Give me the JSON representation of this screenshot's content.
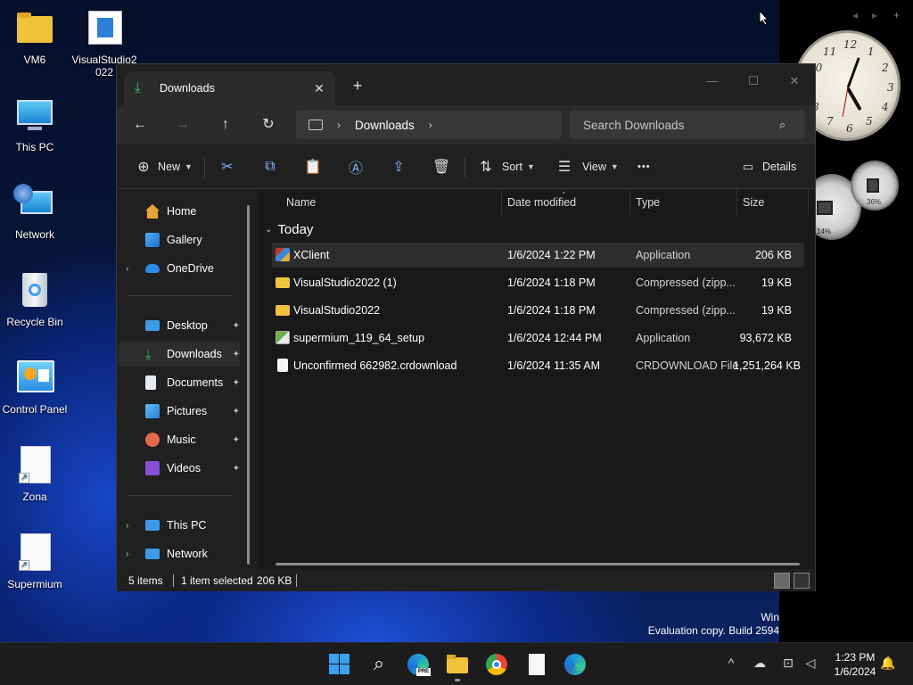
{
  "desktop": {
    "icons": [
      {
        "label": "VM6"
      },
      {
        "label": "VisualStudio2022"
      },
      {
        "label": "This PC"
      },
      {
        "label": "Network"
      },
      {
        "label": "Recycle Bin"
      },
      {
        "label": "Control Panel"
      },
      {
        "label": "Zona"
      },
      {
        "label": "Supermium"
      }
    ],
    "gauge_left_value": "14%",
    "gauge_right_value": "36%",
    "watermark": {
      "line1": "Win",
      "line2": "Evaluation copy. Build 2594"
    }
  },
  "window": {
    "tab_title": "Downloads",
    "tab_close": "✕",
    "new_tab": "+",
    "controls": {
      "minimize": "—",
      "maximize": "☐",
      "close": "✕"
    },
    "nav": {
      "back": "←",
      "forward": "→",
      "up": "↑",
      "refresh": "↻"
    },
    "address": {
      "chevron": "›",
      "crumb": "Downloads",
      "chevron_end": "›"
    },
    "search_placeholder": "Search Downloads",
    "toolbar": {
      "new_label": "New",
      "sort_label": "Sort",
      "view_label": "View",
      "more_label": "•••",
      "details_label": "Details"
    },
    "sidebar": {
      "items": [
        {
          "label": "Home",
          "icon": "home-icon"
        },
        {
          "label": "Gallery",
          "icon": "gallery-icon"
        },
        {
          "label": "OneDrive",
          "icon": "onedrive-icon"
        },
        {
          "label": "Desktop",
          "icon": "desktop-icon"
        },
        {
          "label": "Downloads",
          "icon": "downloads-icon"
        },
        {
          "label": "Documents",
          "icon": "documents-icon"
        },
        {
          "label": "Pictures",
          "icon": "pictures-icon"
        },
        {
          "label": "Music",
          "icon": "music-icon"
        },
        {
          "label": "Videos",
          "icon": "videos-icon"
        },
        {
          "label": "This PC",
          "icon": "this-pc-icon"
        },
        {
          "label": "Network",
          "icon": "network-icon"
        }
      ],
      "expand_arrow": "›",
      "pin": "📌"
    },
    "columns": {
      "name": "Name",
      "date": "Date modified",
      "type": "Type",
      "size": "Size"
    },
    "group": {
      "label": "Today",
      "caret": "⌄"
    },
    "files": [
      {
        "name": "XClient",
        "date": "1/6/2024 1:22 PM",
        "type": "Application",
        "size": "206 KB"
      },
      {
        "name": "VisualStudio2022 (1)",
        "date": "1/6/2024 1:18 PM",
        "type": "Compressed (zipp...",
        "size": "19 KB"
      },
      {
        "name": "VisualStudio2022",
        "date": "1/6/2024 1:18 PM",
        "type": "Compressed (zipp...",
        "size": "19 KB"
      },
      {
        "name": "supermium_119_64_setup",
        "date": "1/6/2024 12:44 PM",
        "type": "Application",
        "size": "93,672 KB"
      },
      {
        "name": "Unconfirmed 662982.crdownload",
        "date": "1/6/2024 11:35 AM",
        "type": "CRDOWNLOAD File",
        "size": "1,251,264 KB"
      }
    ],
    "status": {
      "items": "5 items",
      "selected": "1 item selected",
      "size": "206 KB"
    }
  },
  "taskbar": {
    "time": "1:23 PM",
    "date": "1/6/2024",
    "tray_up": "^"
  }
}
